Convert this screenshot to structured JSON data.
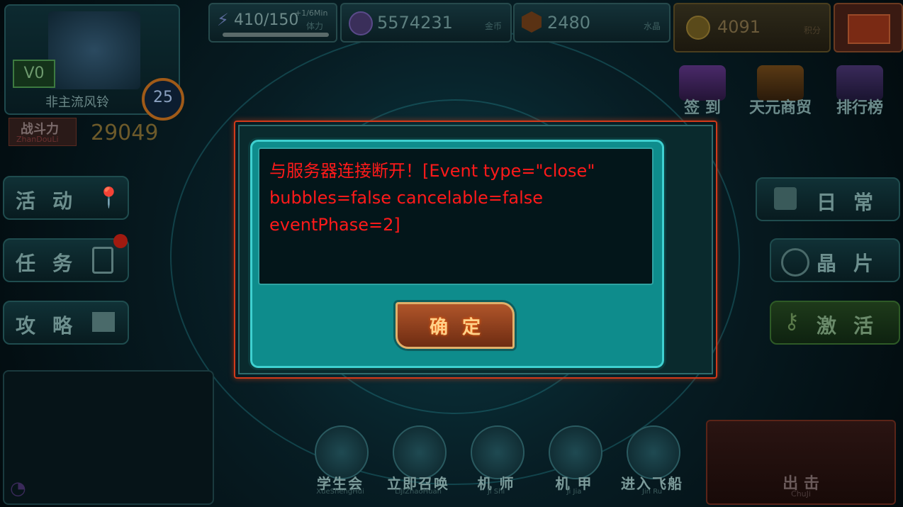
{
  "player": {
    "vip": "V0",
    "name": "非主流风铃",
    "level": "25",
    "power_label": "战斗力",
    "power_label_pinyin": "ZhanDouLi",
    "power_value": "29049"
  },
  "resources": {
    "stamina": "410/150",
    "stamina_rate": "+1/6Min",
    "stamina_unit": "体力",
    "gold": "5574231",
    "gold_unit": "金币",
    "crystal": "2480",
    "crystal_unit": "水晶",
    "points": "4091",
    "points_unit": "积分"
  },
  "top_menu": [
    {
      "label": "签 到",
      "icon": "checkin-icon"
    },
    {
      "label": "天元商贸",
      "icon": "shop-icon"
    },
    {
      "label": "排行榜",
      "icon": "ranking-icon"
    }
  ],
  "left_menu": [
    {
      "label": "活动"
    },
    {
      "label": "任务"
    },
    {
      "label": "攻略"
    }
  ],
  "right_menu": [
    {
      "label": "日常"
    },
    {
      "label": "晶片"
    },
    {
      "label": "激活"
    }
  ],
  "bottom_menu": [
    {
      "label": "学生会",
      "sub": "XueShengHui"
    },
    {
      "label": "立即召唤",
      "sub": "LiJiZhaoHuan"
    },
    {
      "label": "机 师",
      "sub": "Ji Shi"
    },
    {
      "label": "机 甲",
      "sub": "Ji Jia"
    },
    {
      "label": "进入飞船",
      "sub": "Jin Ru"
    }
  ],
  "sortie": {
    "label": "出 击",
    "sub": "ChuJi"
  },
  "dialog": {
    "message": "与服务器连接断开！[Event type=\"close\" bubbles=false cancelable=false eventPhase=2]",
    "ok_label": "确定"
  },
  "colors": {
    "error_text": "#ff1a1a",
    "dialog_teal": "#0e8c8c",
    "alert_border": "#d23a1a"
  }
}
